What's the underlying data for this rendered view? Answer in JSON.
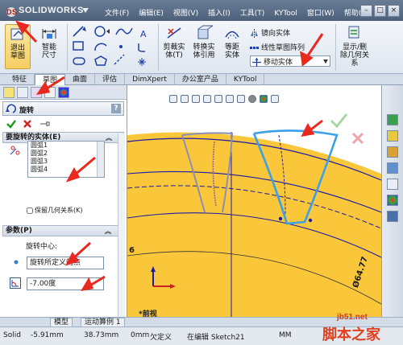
{
  "titlebar": {
    "logo": "SOLIDWORKS",
    "logo_ds": "DS",
    "menus": [
      "文件(F)",
      "编辑(E)",
      "视图(V)",
      "插入(I)",
      "工具(T)",
      "KYTool",
      "窗口(W)",
      "帮助(H)"
    ],
    "window_buttons": [
      "–",
      "□",
      "×"
    ]
  },
  "ribbon": {
    "exit_sketch": "退出草图",
    "smart_dim": "智能尺寸",
    "trim": "剪裁实体(T)",
    "convert": "转换实体引用",
    "offset": "等距实体",
    "mirror": "镜向实体",
    "linear_pattern": "线性草图阵列",
    "move": "移动实体",
    "show_hide": "显示/删除几何关系"
  },
  "tabs": [
    "特征",
    "草图",
    "曲面",
    "评估",
    "DimXpert",
    "办公室产品",
    "KYTool"
  ],
  "active_tab": "草图",
  "panel": {
    "title": "旋转",
    "help": "?",
    "group_entities": "要旋转的实体(E)",
    "entities": [
      "圆弧1",
      "圆弧2",
      "圆弧3",
      "圆弧4"
    ],
    "keep_relations": "保留几何关系(K)",
    "group_params": "参数(P)",
    "center_label": "旋转中心:",
    "center_value": "旋转所定义的点",
    "angle_value": "-7.00度"
  },
  "graphics": {
    "view_label": "*前视",
    "dim_left": "6",
    "dim_right": "Ø64.77"
  },
  "bottom_tabs": [
    "模型",
    "运动算例 1"
  ],
  "status": {
    "app": "Solid",
    "x": "-5.91mm",
    "y": "38.73mm",
    "z": "0mm",
    "state": "欠定义",
    "editing": "在编辑 Sketch21",
    "units": "MM"
  },
  "watermark": {
    "site": "jb51.net",
    "name": "脚本之家"
  },
  "colors": {
    "gear_fill": "#fbc73a",
    "annotation": "#e8291f",
    "selection": "#3aa0e8",
    "sketch": "#1a1aa8"
  }
}
